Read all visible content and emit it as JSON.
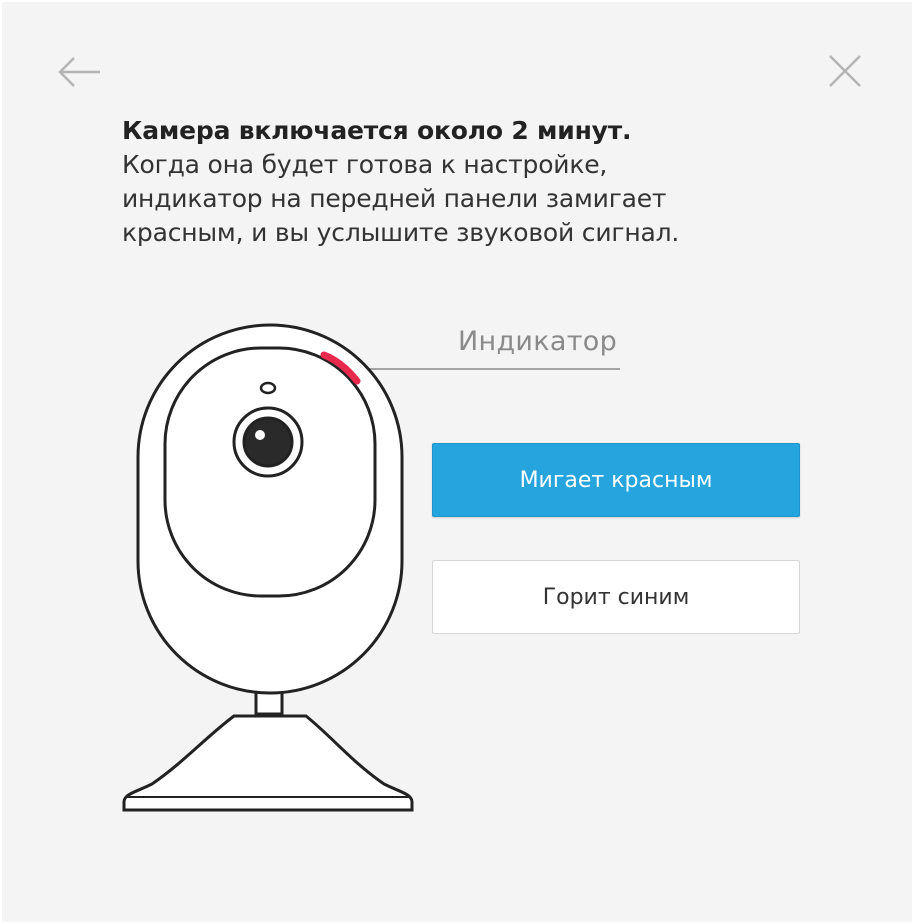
{
  "header": {
    "back_icon": "arrow-left-icon",
    "close_icon": "close-icon"
  },
  "message": {
    "title": "Камера включается около 2 минут.",
    "line1": "Когда она будет готова к настройке,",
    "line2": "индикатор на передней панели замигает",
    "line3": "красным, и вы услышите звуковой сигнал."
  },
  "illustration": {
    "indicator_label": "Индикатор",
    "indicator_color": "#e8294e"
  },
  "actions": {
    "blinking_red_label": "Мигает красным",
    "solid_blue_label": "Горит синим",
    "primary_color": "#25a4dd"
  }
}
